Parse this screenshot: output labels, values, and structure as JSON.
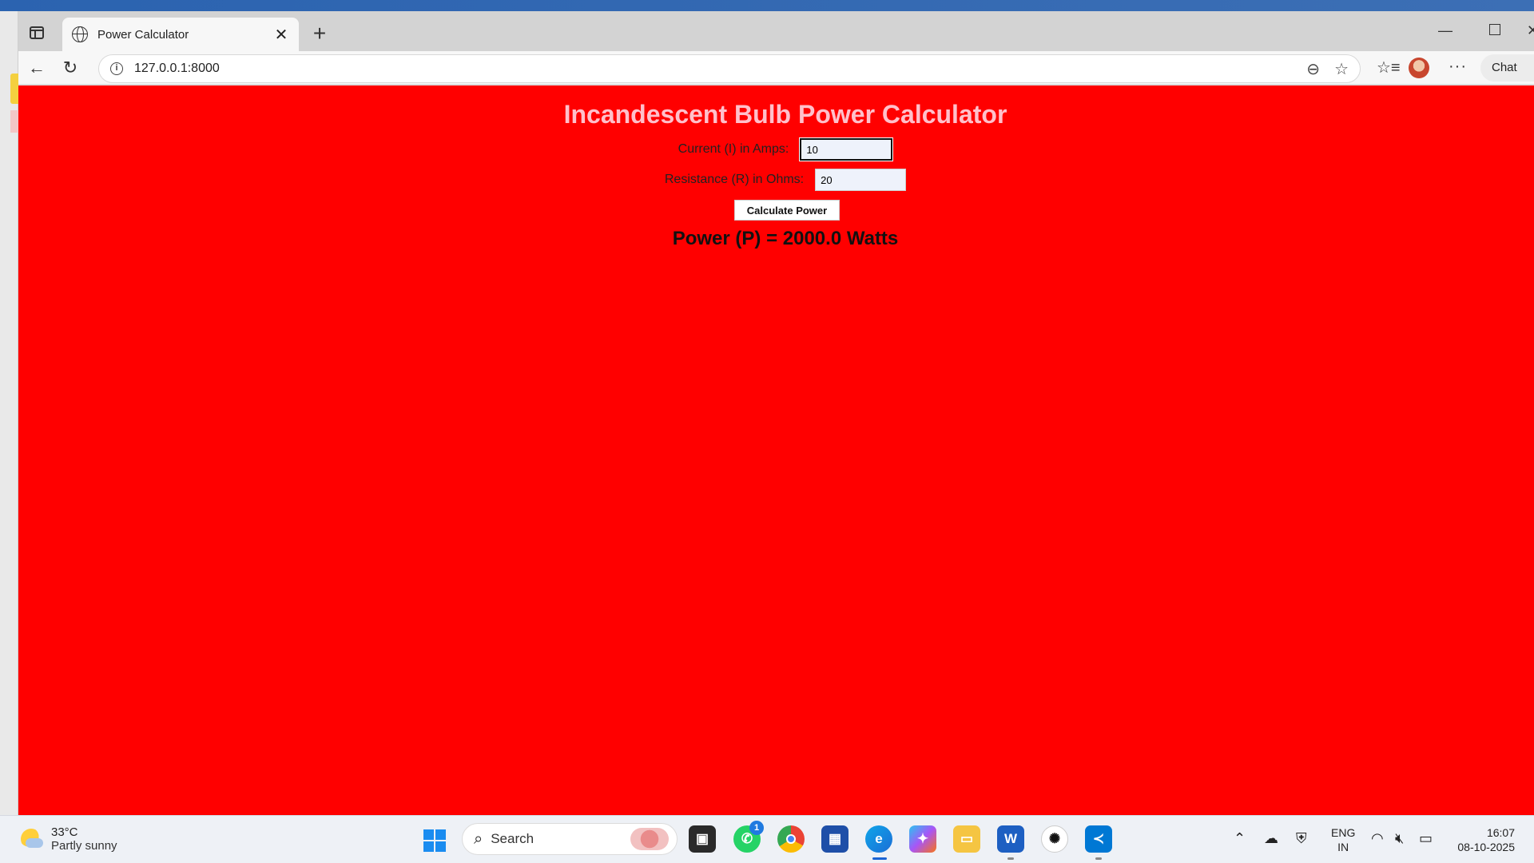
{
  "browser": {
    "tab_title": "Power Calculator",
    "url": "127.0.0.1:8000",
    "chat_label": "Chat"
  },
  "page": {
    "heading": "Incandescent Bulb Power Calculator",
    "current_label": "Current (I) in Amps:",
    "current_value": "10",
    "resistance_label": "Resistance (R) in Ohms:",
    "resistance_value": "20",
    "button_label": "Calculate Power",
    "result": "Power (P) = 2000.0 Watts",
    "background_color": "#ff0000",
    "heading_color": "#ffc0cb"
  },
  "taskbar": {
    "weather_temp": "33°C",
    "weather_condition": "Partly sunny",
    "search_placeholder": "Search",
    "whatsapp_badge": "1",
    "lang_line1": "ENG",
    "lang_line2": "IN",
    "time": "16:07",
    "date": "08-10-2025"
  }
}
